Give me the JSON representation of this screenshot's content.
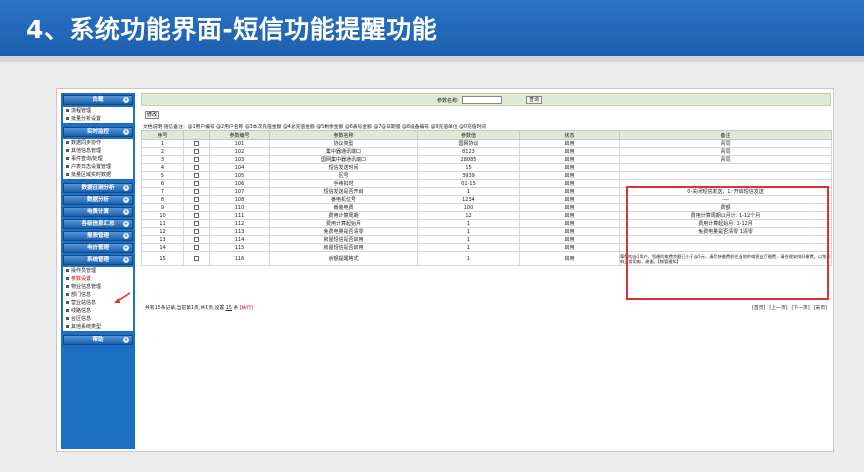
{
  "slide": {
    "title": "4、系统功能界面-短信功能提醒功能"
  },
  "nav": {
    "sections": [
      {
        "label": "负载",
        "items": [
          "流程管理",
          "批量分析设置"
        ]
      },
      {
        "label": "实时监控",
        "items": [
          "数据同步协作",
          "其他信息管理",
          "事件查询/处理",
          "户表日志设置管理",
          "批量区域实时数据"
        ]
      },
      {
        "label": "数据召测分析",
        "items": []
      },
      {
        "label": "数据分析",
        "items": []
      },
      {
        "label": "电费计算",
        "items": []
      },
      {
        "label": "各级信息汇总",
        "items": []
      },
      {
        "label": "报表管理",
        "items": []
      },
      {
        "label": "电价管理",
        "items": []
      },
      {
        "label": "系统管理",
        "items": [
          "操作员管理",
          "参数设置",
          "物业信息管理",
          "部门信息",
          "营业站信息",
          "线路信息",
          "台区信息",
          "其他系统类型"
        ]
      },
      {
        "label": "帮助",
        "items": []
      }
    ],
    "active_item": "参数设置"
  },
  "search": {
    "label": "参数名称:",
    "value": "",
    "button": "查询"
  },
  "toolbar": {
    "modify_label": "修改"
  },
  "hint": "文档说明  短信备注：@1用户编号 @2用户名称 @3本次充值金额 @4总充值金额 @5剩余金额 @6表号金额 @7@日期量  @8设备编号 @9充值单位 @0充值时间",
  "table": {
    "columns": [
      "序号",
      "",
      "参数编号",
      "参数名称",
      "参数值",
      "状态",
      "备注"
    ],
    "rows": [
      {
        "no": "1",
        "code": "101",
        "name": "协议类型",
        "value": "国网协议",
        "state": "启用",
        "note": "青同"
      },
      {
        "no": "2",
        "code": "102",
        "name": "集中器通讯端口",
        "value": "8123",
        "state": "启用",
        "note": "青同"
      },
      {
        "no": "3",
        "code": "103",
        "name": "国网集中器通讯端口",
        "value": "28085",
        "state": "启用",
        "note": "青同"
      },
      {
        "no": "4",
        "code": "104",
        "name": "短信发送时间",
        "value": "15",
        "state": "启用",
        "note": ""
      },
      {
        "no": "5",
        "code": "105",
        "name": "区号",
        "value": "3939",
        "state": "启用",
        "note": ""
      },
      {
        "no": "6",
        "code": "106",
        "name": "手续扣时",
        "value": "01-15",
        "state": "启用",
        "note": ""
      },
      {
        "no": "7",
        "code": "107",
        "name": "短信发送是否开启",
        "value": "1",
        "state": "启用",
        "note": "0-关闭短信发送；1: 开启短信发送"
      },
      {
        "no": "8",
        "code": "108",
        "name": "番电机位号",
        "value": "1234",
        "state": "启用",
        "note": "----"
      },
      {
        "no": "9",
        "code": "110",
        "name": "番装电费",
        "value": "100",
        "state": "启用",
        "note": "费额"
      },
      {
        "no": "10",
        "code": "111",
        "name": "费用计算周期",
        "value": "12",
        "state": "启用",
        "note": "费用计算周期以月计: 1-12个月"
      },
      {
        "no": "11",
        "code": "112",
        "name": "费用计算起始月",
        "value": "1",
        "state": "启用",
        "note": "费用计算起始月: 1-12月"
      },
      {
        "no": "12",
        "code": "113",
        "name": "免费电量是否清零",
        "value": "1",
        "state": "启用",
        "note": "免费电量是否清零 1清零"
      },
      {
        "no": "13",
        "code": "114",
        "name": "房屋短信是否启用",
        "value": "1",
        "state": "启用",
        "note": ""
      },
      {
        "no": "14",
        "code": "115",
        "name": "房屋短信是否启用",
        "value": "1",
        "state": "启用",
        "note": ""
      },
      {
        "no": "15",
        "code": "116",
        "name": "余额提醒格式",
        "value": "1",
        "state": "启用",
        "note": "尊敬的@1用户，您缴的电费余额已小于@5元，请尽快缴费前往当地供电营业厅缴费，请合理安排好缴费，以免影响正常用电，谢谢。【物管通知】"
      }
    ]
  },
  "footer": {
    "summary": "共有15条记录,当前第1页,共1页,设置",
    "per_page": "15",
    "per_page_suffix": "条",
    "jump": "[执行]",
    "pager": [
      "[首页]",
      "[上一页]",
      "[下一页]",
      "[末页]"
    ]
  },
  "colors": {
    "banner": "#1c5fae",
    "nav": "#1c6fc2",
    "highlight": "#e23131",
    "state": "#1a8a1a"
  }
}
